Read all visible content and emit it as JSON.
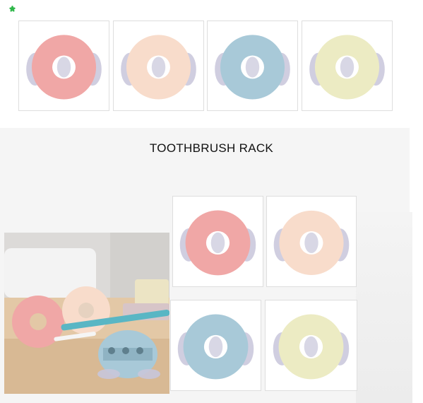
{
  "caption": "TOOTHBRUSH RACK",
  "colors": {
    "pink": "#f0a7a6",
    "cream": "#f8dccb",
    "blue": "#a8c9d8",
    "yellow": "#ecebc3",
    "suction_cup": "#c8c6da",
    "accent_mark": "#2fb74a"
  },
  "products": [
    {
      "name": "pink-ring"
    },
    {
      "name": "cream-ring"
    },
    {
      "name": "blue-ring"
    },
    {
      "name": "yellow-ring"
    }
  ]
}
